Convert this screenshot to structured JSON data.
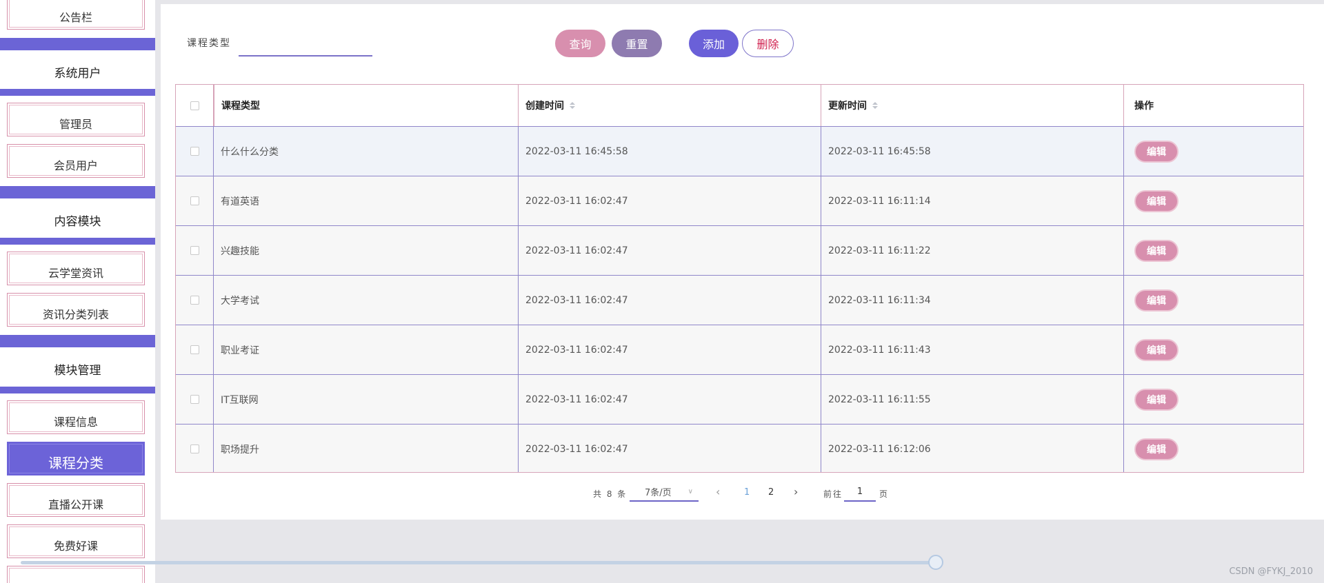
{
  "sidebar": {
    "items": [
      {
        "type": "sub",
        "label": "公告栏"
      },
      {
        "type": "head",
        "label": "系统用户"
      },
      {
        "type": "sub",
        "label": "管理员"
      },
      {
        "type": "sub",
        "label": "会员用户"
      },
      {
        "type": "head",
        "label": "内容模块"
      },
      {
        "type": "sub",
        "label": "云学堂资讯"
      },
      {
        "type": "sub",
        "label": "资讯分类列表"
      },
      {
        "type": "head",
        "label": "模块管理"
      },
      {
        "type": "sub",
        "label": "课程信息"
      },
      {
        "type": "sub",
        "label": "课程分类",
        "active": true
      },
      {
        "type": "sub",
        "label": "直播公开课"
      },
      {
        "type": "sub",
        "label": "免费好课"
      }
    ]
  },
  "search": {
    "label": "课程类型",
    "value": "",
    "placeholder": ""
  },
  "toolbar": {
    "query_label": "查询",
    "reset_label": "重置",
    "add_label": "添加",
    "delete_label": "删除"
  },
  "table": {
    "columns": [
      "课程类型",
      "创建时间",
      "更新时间",
      "操作"
    ],
    "edit_label": "编辑",
    "rows": [
      {
        "type": "什么什么分类",
        "created": "2022-03-11 16:45:58",
        "updated": "2022-03-11 16:45:58"
      },
      {
        "type": "有道英语",
        "created": "2022-03-11 16:02:47",
        "updated": "2022-03-11 16:11:14"
      },
      {
        "type": "兴趣技能",
        "created": "2022-03-11 16:02:47",
        "updated": "2022-03-11 16:11:22"
      },
      {
        "type": "大学考试",
        "created": "2022-03-11 16:02:47",
        "updated": "2022-03-11 16:11:34"
      },
      {
        "type": "职业考证",
        "created": "2022-03-11 16:02:47",
        "updated": "2022-03-11 16:11:43"
      },
      {
        "type": "IT互联网",
        "created": "2022-03-11 16:02:47",
        "updated": "2022-03-11 16:11:55"
      },
      {
        "type": "职场提升",
        "created": "2022-03-11 16:02:47",
        "updated": "2022-03-11 16:12:06"
      }
    ]
  },
  "pagination": {
    "total_text": "共 8 条",
    "page_size": "7条/页",
    "pages": [
      "1",
      "2"
    ],
    "current_page": "1",
    "goto_label": "前往",
    "goto_value": "1",
    "page_suffix": "页"
  },
  "watermark": "CSDN @FYKJ_2010",
  "colors": {
    "accent": "#6b64d6",
    "pink": "#d88fae",
    "reset": "#8e7bb0",
    "danger_text": "#d0214f"
  }
}
